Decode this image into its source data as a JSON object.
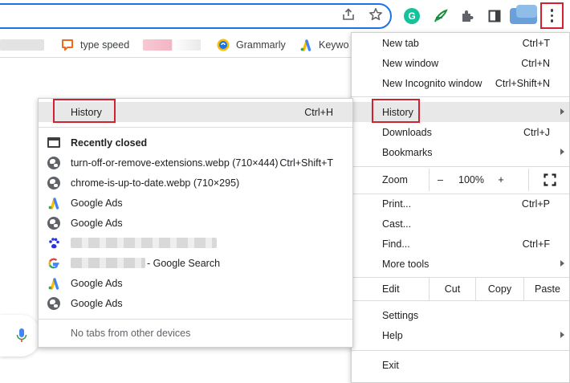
{
  "bookmarks": [
    {
      "label": "type speed",
      "icon": "speech-bubble-icon",
      "color": "#f06a1d"
    },
    {
      "label": "Grammarly",
      "icon": "grammarly-icon",
      "color": "#15c39a"
    },
    {
      "label": "Keywo",
      "icon": "google-ads-icon",
      "color": "#4285f4"
    }
  ],
  "main_menu": {
    "new_tab": {
      "label": "New tab",
      "shortcut": "Ctrl+T"
    },
    "new_window": {
      "label": "New window",
      "shortcut": "Ctrl+N"
    },
    "new_incognito": {
      "label": "New Incognito window",
      "shortcut": "Ctrl+Shift+N"
    },
    "history": {
      "label": "History"
    },
    "downloads": {
      "label": "Downloads",
      "shortcut": "Ctrl+J"
    },
    "bookmarks": {
      "label": "Bookmarks"
    },
    "zoom": {
      "label": "Zoom",
      "minus": "–",
      "level": "100%",
      "plus": "+"
    },
    "print": {
      "label": "Print...",
      "shortcut": "Ctrl+P"
    },
    "cast": {
      "label": "Cast..."
    },
    "find": {
      "label": "Find...",
      "shortcut": "Ctrl+F"
    },
    "more_tools": {
      "label": "More tools"
    },
    "edit": {
      "label": "Edit",
      "cut": "Cut",
      "copy": "Copy",
      "paste": "Paste"
    },
    "settings": {
      "label": "Settings"
    },
    "help": {
      "label": "Help"
    },
    "exit": {
      "label": "Exit"
    }
  },
  "history_menu": {
    "history": {
      "label": "History",
      "shortcut": "Ctrl+H"
    },
    "recently_closed": "Recently closed",
    "items": [
      {
        "label": "turn-off-or-remove-extensions.webp (710×444)",
        "shortcut": "Ctrl+Shift+T",
        "icon": "globe-icon"
      },
      {
        "label": "chrome-is-up-to-date.webp (710×295)",
        "shortcut": "",
        "icon": "globe-icon"
      },
      {
        "label": "Google Ads",
        "shortcut": "",
        "icon": "google-ads-icon"
      },
      {
        "label": "Google Ads",
        "shortcut": "",
        "icon": "globe-icon"
      },
      {
        "label": "",
        "shortcut": "",
        "icon": "baidu-paw-icon"
      },
      {
        "label": " - Google Search",
        "shortcut": "",
        "icon": "google-g-icon"
      },
      {
        "label": "Google Ads",
        "shortcut": "",
        "icon": "google-ads-icon"
      },
      {
        "label": "Google Ads",
        "shortcut": "",
        "icon": "globe-icon"
      }
    ],
    "no_tabs": "No tabs from other devices"
  },
  "colors": {
    "highlight_box": "#d0222f",
    "omnibox_border": "#1a73e8",
    "menu_hover": "#e8e8e8"
  }
}
